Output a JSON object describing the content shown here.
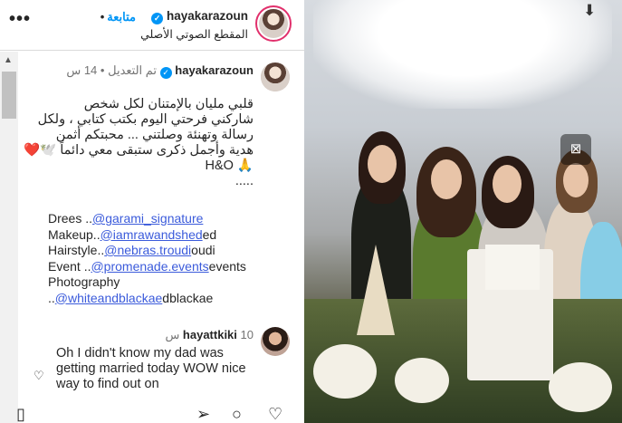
{
  "header": {
    "username": "hayakarazoun",
    "follow_label": "متابعة",
    "audio_label": "المقطع الصوتي الأصلي",
    "more_icon": "more-horizontal-icon"
  },
  "caption": {
    "username": "hayakarazoun",
    "edited_label": "تم التعديل",
    "time": "14 س",
    "text": "قلبي مليان بالإمتنان لكل شخص\nشاركني فرحتي اليوم بكتب كتابي ، ولكل\nرسالة وتهنئة وصلتني ... محبتكم أثمن\nهدية وأجمل ذكرى ستبقى معي دائماً 🕊️❤️🙏 H&O\n.....",
    "credits": [
      {
        "prefix": "Drees ..",
        "handle": "@garami_signature",
        "suffix": ""
      },
      {
        "prefix": "Makeup..",
        "handle": "@iamrawandshed",
        "suffix": "ed"
      },
      {
        "prefix": "Hairstyle..",
        "handle": "@nebras.troudi",
        "suffix": "oudi"
      },
      {
        "prefix": "Event ..",
        "handle": "@promenade.events",
        "suffix": "events"
      },
      {
        "prefix": "Photography",
        "handle": "",
        "suffix": ""
      },
      {
        "prefix": "..",
        "handle": "@whiteandblackae",
        "suffix": "dblackae"
      }
    ]
  },
  "comment": {
    "username": "hayattkiki",
    "time": "10 س",
    "text": "Oh I didn't know my dad was getting married today WOW nice way to find out on"
  },
  "actions": {
    "icons": [
      "bookmark-icon",
      "share-icon",
      "comment-icon",
      "like-icon"
    ]
  }
}
